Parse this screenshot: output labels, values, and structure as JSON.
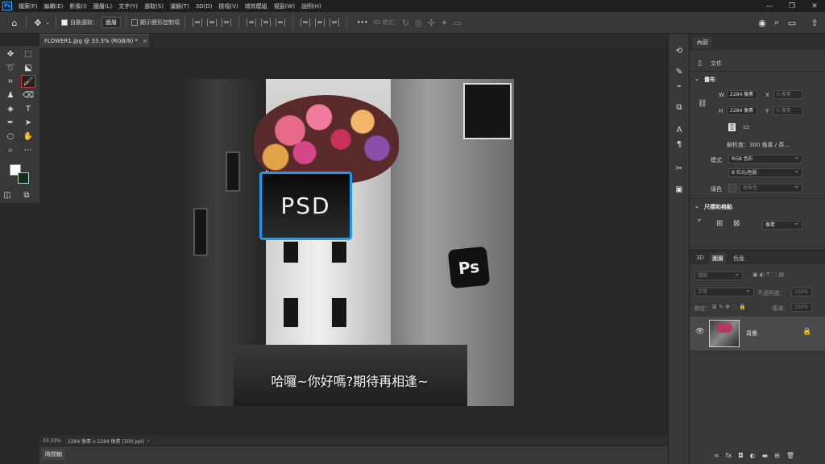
{
  "menubar": {
    "app_logo": "Ps",
    "items": [
      "檔案(F)",
      "編輯(E)",
      "影像(I)",
      "圖層(L)",
      "文字(Y)",
      "選取(S)",
      "濾鏡(T)",
      "3D(D)",
      "檢視(V)",
      "增效模組",
      "視窗(W)",
      "說明(H)"
    ],
    "window_controls": [
      "—",
      "❐",
      "✕"
    ]
  },
  "options_bar": {
    "auto_select_label": "自動選取：",
    "auto_select_value": "圖層",
    "show_transform_label": "顯示變形控制項",
    "mode_3d_label": "3D 模式：",
    "more_label": "•••"
  },
  "document_tab": {
    "title": "FLOWER1.jpg @ 33.3% (RGB/8) *",
    "close": "×"
  },
  "canvas": {
    "psd_text": "PSD",
    "ps_badge": "Ps",
    "caption": "哈囉~你好嗎?期待再相逢~"
  },
  "statusbar": {
    "zoom": "33.33%",
    "doc_info": "2284 像素 x 2284 像素 (300 ppi)",
    "arrow": "›"
  },
  "timeline": {
    "tab_label": "時間軸"
  },
  "properties": {
    "tab_label": "內容",
    "doc_label": "文件",
    "canvas_head": "畫布",
    "w_label": "W",
    "w_value": "2284 像素",
    "x_label": "X",
    "x_value": "0 像素",
    "h_label": "H",
    "h_value": "2284 像素",
    "y_label": "Y",
    "y_value": "0 像素",
    "resolution": "解析度：300 像素 / 英...",
    "mode_label": "模式",
    "mode_value": "RGB 色彩",
    "depth_value": "8 位元/色版",
    "fill_label": "填色",
    "fill_value": "背景色",
    "rulers_head": "尺標和格點",
    "unit_value": "像素"
  },
  "layers": {
    "tabs": [
      "3D",
      "圖層",
      "色版"
    ],
    "search_placeholder": "種類",
    "blend_mode": "正常",
    "opacity_label": "不透明度：",
    "opacity_value": "100%",
    "lock_label": "鎖定：",
    "fill_label": "填滿：",
    "fill_value": "100%",
    "layer_name": "背景",
    "bottom_icons": [
      "∞",
      "fx",
      "◘",
      "◐",
      "▬",
      "⊞",
      "🗑"
    ]
  },
  "colors": {
    "accent_red": "#d33a2c",
    "ps_blue": "#31a8ff",
    "panel_bg": "#383838"
  }
}
